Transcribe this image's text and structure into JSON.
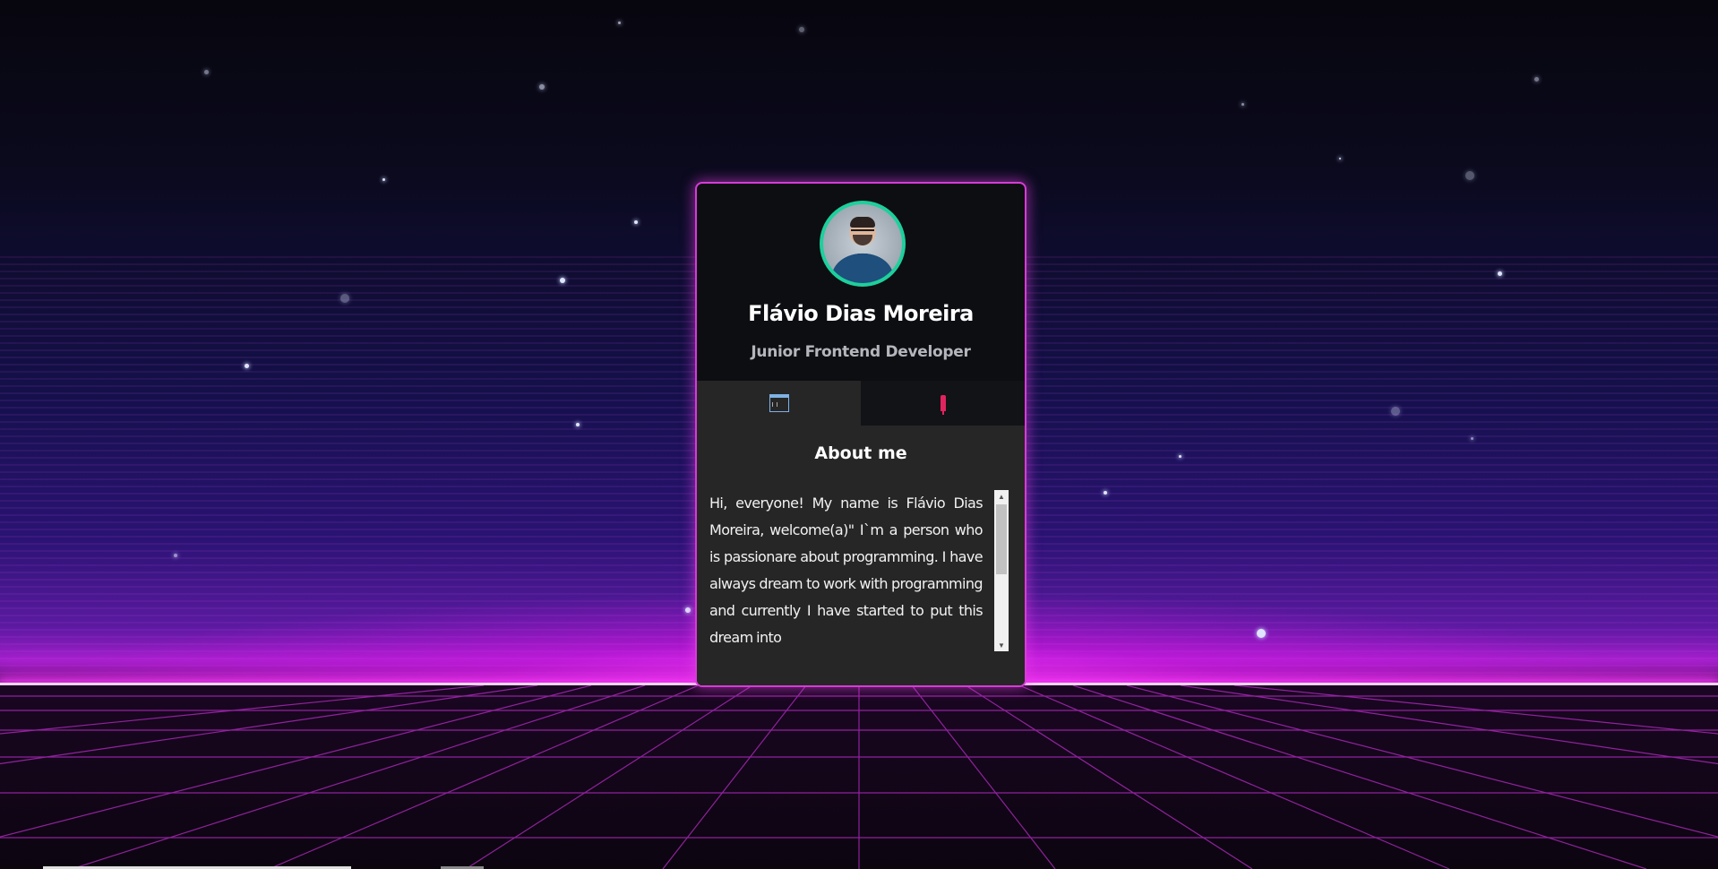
{
  "profile": {
    "name": "Flávio Dias Moreira",
    "role": "Junior Frontend Developer"
  },
  "tabs": [
    {
      "icon": "window-icon",
      "active": true
    },
    {
      "icon": "pushpin-icon",
      "active": false
    }
  ],
  "about": {
    "title": "About me",
    "text": "Hi, everyone! My name is Flávio Dias Moreira, welcome(a)\" I`m a person who is passionare about programming. I have always dream to work with programming and currently I have started to put this dream into"
  },
  "colors": {
    "card_border": "#d63cd6",
    "avatar_ring": "#1ecf9c",
    "card_background": "#0c0e11",
    "panel_background": "#262626",
    "horizon_glow": "#ff3cff"
  }
}
